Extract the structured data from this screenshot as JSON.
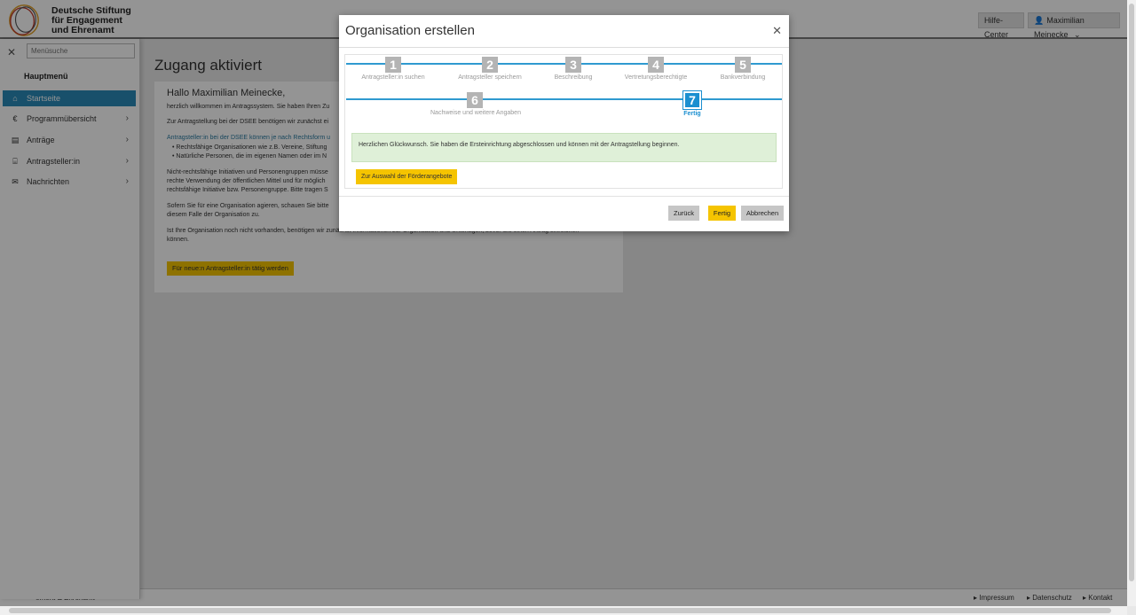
{
  "header": {
    "logo_line1": "Deutsche Stiftung",
    "logo_line2": "für Engagement",
    "logo_line3": "und Ehrenamt",
    "help_label": "Hilfe-Center",
    "user_label": "Maximilian Meinecke"
  },
  "sidebar": {
    "search_placeholder": "Menüsuche",
    "title": "Hauptmenü",
    "items": [
      {
        "label": "Startseite",
        "icon": "home-icon"
      },
      {
        "label": "Programmübersicht",
        "icon": "euro-icon"
      },
      {
        "label": "Anträge",
        "icon": "document-icon"
      },
      {
        "label": "Antragsteller:in",
        "icon": "bank-icon"
      },
      {
        "label": "Nachrichten",
        "icon": "mail-icon"
      }
    ]
  },
  "main": {
    "page_title": "Zugang aktiviert",
    "greeting": "Hallo Maximilian Meinecke,",
    "p1": "herzlich willkommen im Antragssystem. Sie haben Ihren Zu",
    "p2": "Zur Antragstellung bei der DSEE benötigen wir zunächst ei",
    "p3": "Antragsteller:in bei der DSEE können je nach Rechtsform u",
    "b1": "Rechtsfähige Organisationen wie z.B. Vereine, Stiftung",
    "b2": "Natürliche Personen, die im eigenen Namen oder im N",
    "p4a": "Nicht-rechtsfähige Initiativen und Personengruppen müsse",
    "p4b": "rechte Verwendung der öffentlichen Mittel und für möglich",
    "p4c": "rechtsfähige Initiative bzw. Personengruppe. Bitte tragen S",
    "p5a": "Sofern Sie für eine Organisation agieren, schauen Sie bitte",
    "p5b": "diesem Falle der Organisation zu.",
    "p6a": "Ist Ihre Organisation noch nicht vorhanden, benötigen wir zunächst Informationen zur Organisation und Unterlagen, bevor Sie einen Antrag einreichen",
    "p6b": "können.",
    "button": "Für neue:n Antragsteller:in tätig werden"
  },
  "footer": {
    "left": "ement & Ehrenamt",
    "links": [
      "Impressum",
      "Datenschutz",
      "Kontakt"
    ]
  },
  "modal": {
    "title": "Organisation erstellen",
    "steps": [
      {
        "num": "1",
        "label": "Antragsteller:in suchen"
      },
      {
        "num": "2",
        "label": "Antragsteller speichern"
      },
      {
        "num": "3",
        "label": "Beschreibung"
      },
      {
        "num": "4",
        "label": "Vertretungsberechtigte"
      },
      {
        "num": "5",
        "label": "Bankverbindung"
      },
      {
        "num": "6",
        "label": "Nachweise und weitere Angaben"
      },
      {
        "num": "7",
        "label": "Fertig"
      }
    ],
    "active_step": 7,
    "success_message": "Herzlichen Glückwunsch. Sie haben die Ersteinrichtung abgeschlossen und können mit der Antragstellung beginnen.",
    "offers_button": "Zur Auswahl der Förderangebote",
    "back_button": "Zurück",
    "done_button": "Fertig",
    "cancel_button": "Abbrechen"
  },
  "colors": {
    "accent": "#2f9ad0",
    "button_yellow": "#f5c400",
    "success_bg": "#dff0d8",
    "sidebar_active": "#2a8ab8"
  }
}
